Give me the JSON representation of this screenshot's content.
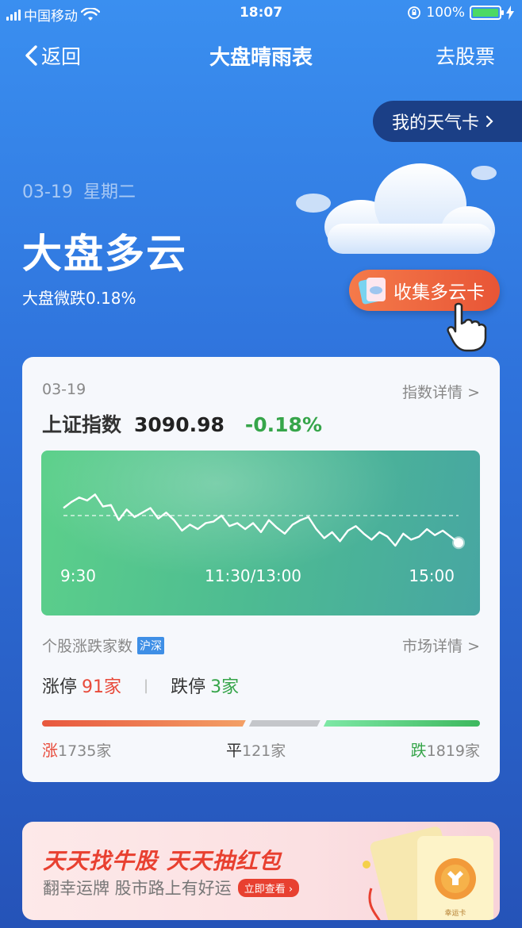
{
  "status_bar": {
    "carrier": "中国移动",
    "time": "18:07",
    "battery": "100%"
  },
  "nav": {
    "back_label": "返回",
    "title": "大盘晴雨表",
    "right_label": "去股票"
  },
  "weather_card_label": "我的天气卡",
  "weather": {
    "date": "03-19",
    "weekday": "星期二",
    "title": "大盘多云",
    "subtitle": "大盘微跌0.18%",
    "collect_label": "收集多云卡"
  },
  "index_card": {
    "date": "03-19",
    "detail_label": "指数详情 >",
    "index_name": "上证指数",
    "index_value": "3090.98",
    "index_change": "-0.18%",
    "time_ticks": [
      "9:30",
      "11:30/13:00",
      "15:00"
    ],
    "colors": {
      "up": "#e84a3a",
      "down": "#36a54a"
    }
  },
  "chart_data": {
    "type": "line",
    "x_ticks": [
      "9:30",
      "11:30/13:00",
      "15:00"
    ],
    "reference_line": 0,
    "series": [
      {
        "values": [
          0.05,
          0.09,
          0.12,
          0.1,
          0.14,
          0.06,
          0.07,
          -0.03,
          0.04,
          -0.01,
          0.02,
          0.05,
          -0.02,
          0.02,
          -0.03,
          -0.1,
          -0.06,
          -0.09,
          -0.05,
          -0.04,
          0.0,
          -0.07,
          -0.05,
          -0.09,
          -0.05,
          -0.11,
          -0.03,
          -0.08,
          -0.12,
          -0.06,
          -0.03,
          -0.01,
          -0.09,
          -0.15,
          -0.11,
          -0.17,
          -0.1,
          -0.07,
          -0.12,
          -0.16,
          -0.11,
          -0.14,
          -0.2,
          -0.12,
          -0.16,
          -0.14,
          -0.09,
          -0.13,
          -0.1,
          -0.14,
          -0.18
        ]
      }
    ]
  },
  "stocks": {
    "label": "个股涨跌家数",
    "market_badge": "沪深",
    "detail_label": "市场详情 >",
    "limit_up_label": "涨停",
    "limit_up_value": "91家",
    "limit_down_label": "跌停",
    "limit_down_value": "3家",
    "up_label": "涨",
    "up_count": "1735家",
    "flat_label": "平",
    "flat_count": "121家",
    "down_label": "跌",
    "down_count": "1819家",
    "up_number": 1735,
    "flat_number": 121,
    "down_number": 1819
  },
  "banner": {
    "title": "天天找牛股 天天抽红包",
    "subtitle": "翻幸运牌 股市路上有好运",
    "cta": "立即查看",
    "card_text": "幸运卡"
  }
}
